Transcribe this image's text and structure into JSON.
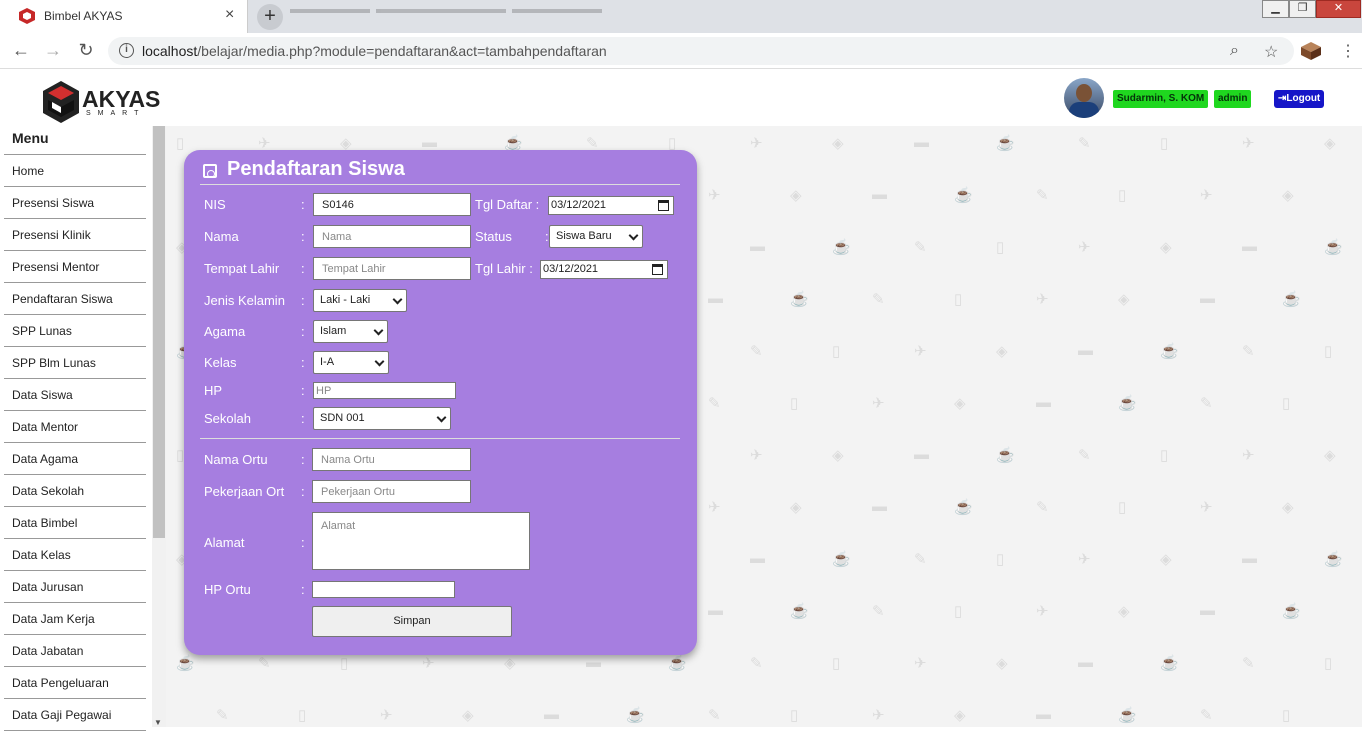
{
  "browser": {
    "tab_title": "Bimbel AKYAS",
    "tab_close": "×",
    "new_tab": "+",
    "url_host": "localhost",
    "url_path": "/belajar/media.php?module=pendaftaran&act=tambahpendaftaran",
    "icons": [
      "back-arrow-icon",
      "forward-arrow-icon",
      "reload-icon",
      "info-icon",
      "zoom-icon",
      "star-icon",
      "extension-icon",
      "more-icon"
    ]
  },
  "header": {
    "brand": "AKYAS",
    "brand_sub": "SMART",
    "user_name": "Sudarmin, S. KOM",
    "user_role": "admin",
    "logout": "Logout"
  },
  "sidebar": {
    "title": "Menu",
    "items": [
      "Home",
      "Presensi Siswa",
      "Presensi Klinik",
      "Presensi Mentor",
      "Pendaftaran Siswa",
      "SPP Lunas",
      "SPP Blm Lunas",
      "Data Siswa",
      "Data Mentor",
      "Data Agama",
      "Data Sekolah",
      "Data Bimbel",
      "Data Kelas",
      "Data Jurusan",
      "Data Jam Kerja",
      "Data Jabatan",
      "Data Pengeluaran",
      "Data Gaji Pegawai"
    ]
  },
  "form": {
    "title": "Pendaftaran Siswa",
    "colon": ":",
    "nis": {
      "label": "NIS",
      "value": "S0146"
    },
    "tgl_daftar": {
      "label": "Tgl Daftar :",
      "value": "03/12/2021"
    },
    "nama": {
      "label": "Nama",
      "placeholder": "Nama"
    },
    "status": {
      "label": "Status",
      "value": "Siswa Baru"
    },
    "tempat_lahir": {
      "label": "Tempat Lahir",
      "placeholder": "Tempat Lahir"
    },
    "tgl_lahir": {
      "label": "Tgl Lahir :",
      "value": "03/12/2021"
    },
    "jenis_kelamin": {
      "label": "Jenis Kelamin",
      "value": "Laki - Laki"
    },
    "agama": {
      "label": "Agama",
      "value": "Islam"
    },
    "kelas": {
      "label": "Kelas",
      "value": "I-A"
    },
    "hp": {
      "label": "HP",
      "placeholder": "HP"
    },
    "sekolah": {
      "label": "Sekolah",
      "value": "SDN 001"
    },
    "nama_ortu": {
      "label": "Nama Ortu",
      "placeholder": "Nama Ortu"
    },
    "pekerjaan_ortu": {
      "label": "Pekerjaan Ort",
      "placeholder": "Pekerjaan Ortu"
    },
    "alamat": {
      "label": "Alamat",
      "placeholder": "Alamat"
    },
    "hp_ortu": {
      "label": "HP Ortu",
      "value": ""
    },
    "submit": "Simpan"
  },
  "colors": {
    "card": "#a67ee0",
    "badge_green": "#1fd71f",
    "logout_blue": "#1616c8",
    "background": "#f3f3f3"
  }
}
